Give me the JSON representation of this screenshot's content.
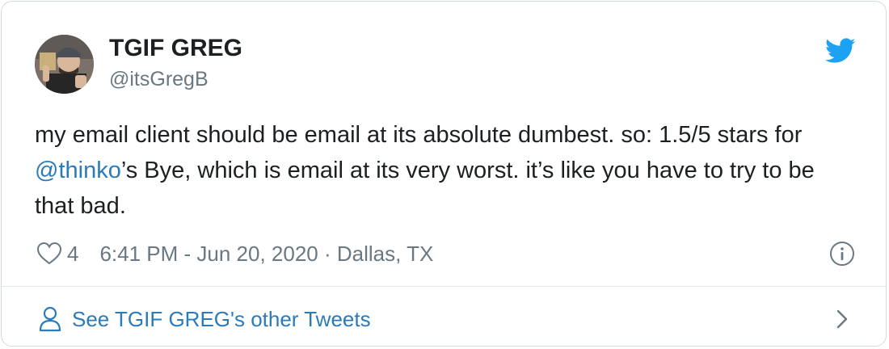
{
  "tweet": {
    "display_name": "TGIF GREG",
    "handle": "@itsGregB",
    "text_parts": {
      "line1": "my email client should be email at its absolute dumbest. so: 1.5/5 stars for ",
      "mention": "@thinko",
      "line2": "’s Bye, which is email at its very worst. it’s like you have to try to be that bad."
    },
    "like_count": "4",
    "timestamp": "6:41 PM - Jun 20, 2020 · Dallas, TX"
  },
  "footer": {
    "other_tweets_label": "See TGIF GREG's other Tweets"
  },
  "colors": {
    "link": "#2b7bb9",
    "twitter_blue": "#1da1f2",
    "muted": "#697882",
    "text": "#1c2022"
  },
  "icons": {
    "logo": "twitter-bird-icon",
    "like": "heart-icon",
    "info": "info-icon",
    "profile": "person-icon",
    "more": "chevron-right-icon"
  }
}
